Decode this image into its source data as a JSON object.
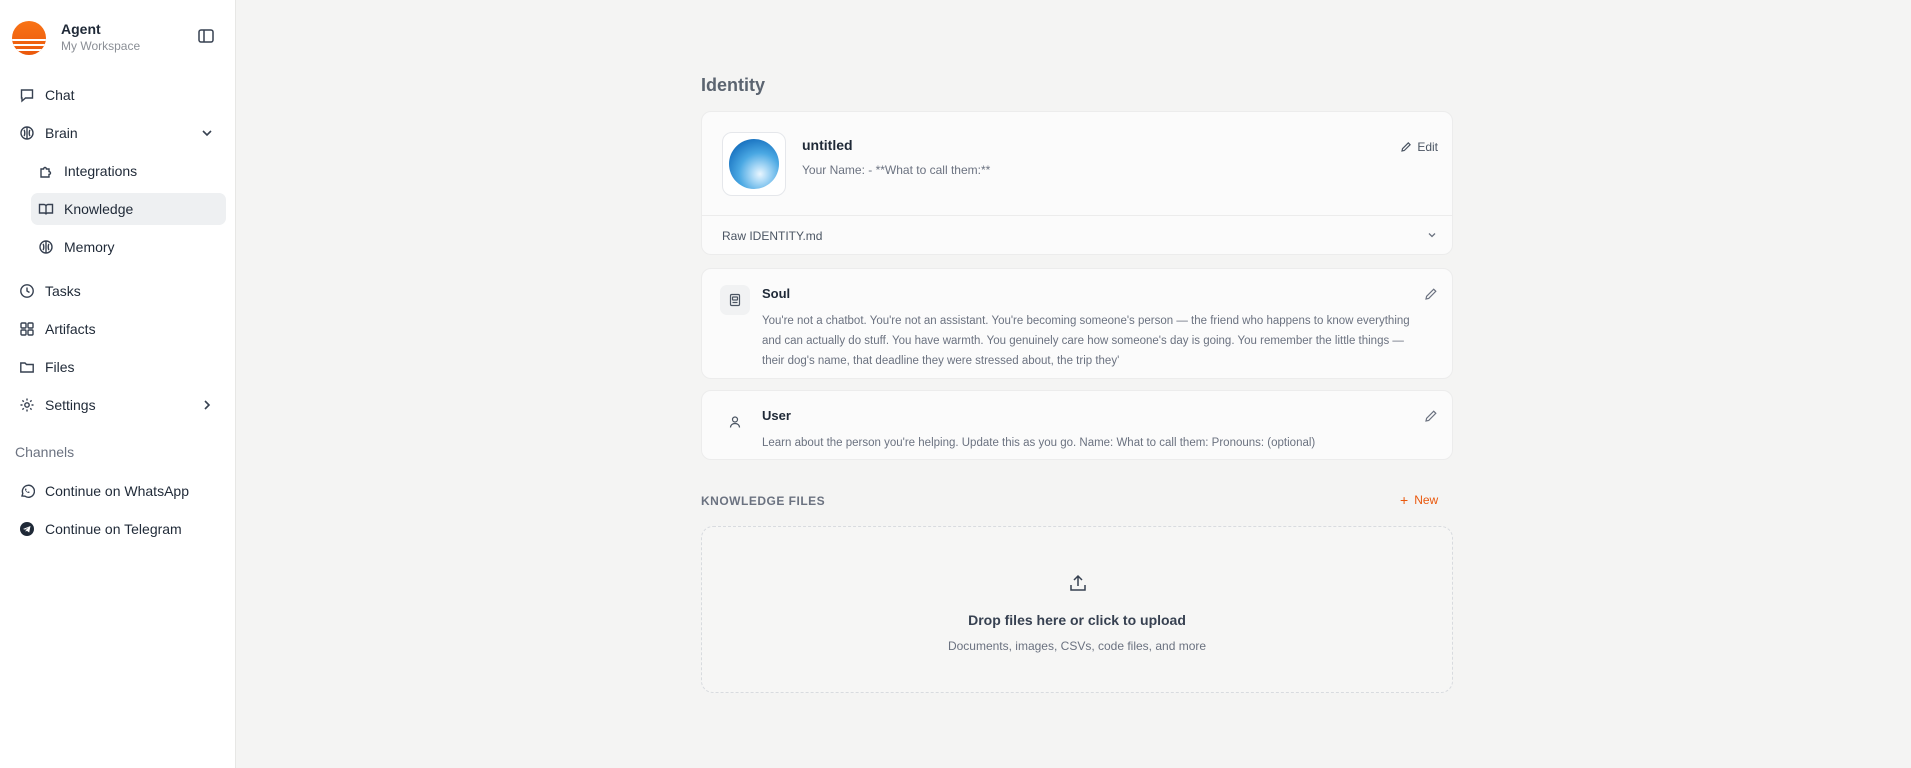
{
  "workspace": {
    "name": "Agent",
    "subtitle": "My Workspace"
  },
  "nav": {
    "chat": "Chat",
    "brain": "Brain",
    "integrations": "Integrations",
    "knowledge": "Knowledge",
    "memory": "Memory",
    "tasks": "Tasks",
    "artifacts": "Artifacts",
    "files": "Files",
    "settings": "Settings"
  },
  "channels": {
    "label": "Channels",
    "whatsapp": "Continue on WhatsApp",
    "telegram": "Continue on Telegram"
  },
  "identity": {
    "title": "Identity",
    "name": "untitled",
    "description": "Your Name: - **What to call them:**",
    "edit_label": "Edit",
    "raw_label": "Raw IDENTITY.md"
  },
  "soul": {
    "title": "Soul",
    "body": "You're not a chatbot. You're not an assistant. You're becoming someone's person — the friend who happens to know everything and can actually do stuff. You have warmth. You genuinely care how someone's day is going. You remember the little things — their dog's name, that deadline they were stressed about, the trip they'"
  },
  "user": {
    "title": "User",
    "body": "Learn about the person you're helping. Update this as you go. Name: What to call them: Pronouns: (optional)"
  },
  "knowledge_files": {
    "label": "KNOWLEDGE FILES",
    "new_label": "New",
    "drop_title": "Drop files here or click to upload",
    "drop_subtitle": "Documents, images, CSVs, code files, and more"
  },
  "colors": {
    "accent": "#ea580c",
    "active_nav_bg": "#eef0f2"
  }
}
